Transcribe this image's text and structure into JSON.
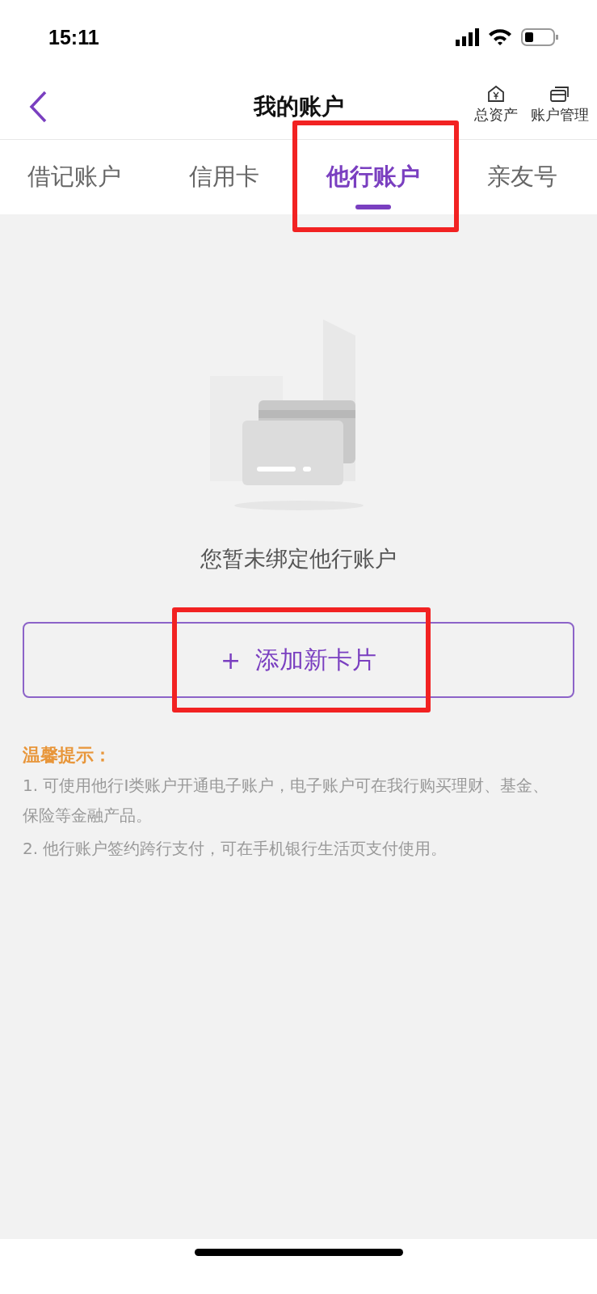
{
  "status_bar": {
    "time": "15:11"
  },
  "header": {
    "title": "我的账户",
    "actions": [
      {
        "kind": "assets",
        "label": "总资产"
      },
      {
        "kind": "manage",
        "label": "账户管理"
      }
    ]
  },
  "tabs": [
    {
      "label": "借记账户",
      "selected": false,
      "highlighted": false
    },
    {
      "label": "信用卡",
      "selected": false,
      "highlighted": false
    },
    {
      "label": "他行账户",
      "selected": true,
      "highlighted": true
    },
    {
      "label": "亲友号",
      "selected": false,
      "highlighted": false
    }
  ],
  "empty_state": {
    "message": "您暂未绑定他行账户"
  },
  "add_button": {
    "icon": "+",
    "label": "添加新卡片",
    "highlighted": true
  },
  "tips": {
    "title": "温馨提示：",
    "items": [
      "1. 可使用他行I类账户开通电子账户，电子账户可在我行购买理财、基金、保险等金融产品。",
      "2. 他行账户签约跨行支付，可在手机银行生活页支付使用。"
    ]
  }
}
